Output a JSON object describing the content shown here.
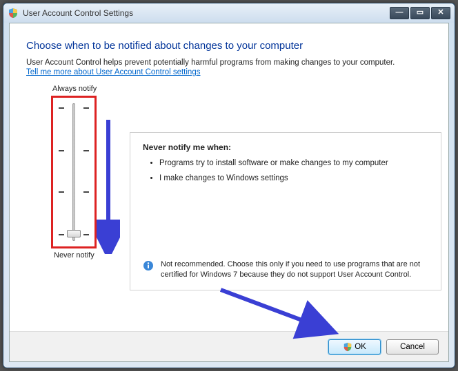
{
  "window": {
    "title": "User Account Control Settings"
  },
  "heading": "Choose when to be notified about changes to your computer",
  "subtext": "User Account Control helps prevent potentially harmful programs from making changes to your computer.",
  "help_link": "Tell me more about User Account Control settings",
  "slider": {
    "top_label": "Always notify",
    "bottom_label": "Never notify"
  },
  "panel": {
    "title": "Never notify me when:",
    "bullets": [
      "Programs try to install software or make changes to my computer",
      "I make changes to Windows settings"
    ],
    "info": "Not recommended. Choose this only if you need to use programs that are not certified for Windows 7 because they do not support User Account Control."
  },
  "buttons": {
    "ok": "OK",
    "cancel": "Cancel"
  },
  "annotation_color": "#3a3fd4"
}
